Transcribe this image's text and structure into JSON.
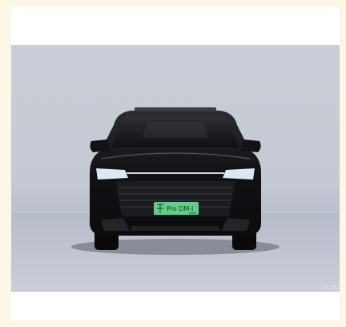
{
  "image": {
    "subject": "black-suv-front-view",
    "plate": {
      "line1": "Pro DM-i",
      "line2": "冠军版"
    },
    "watermark": "汽车之家"
  },
  "colors": {
    "page_bg": "#fbf6e6",
    "card_bg": "#ffffff",
    "studio_bg": "#c6cad4",
    "car_body": "#141518",
    "plate_green": "#5fcf86"
  }
}
